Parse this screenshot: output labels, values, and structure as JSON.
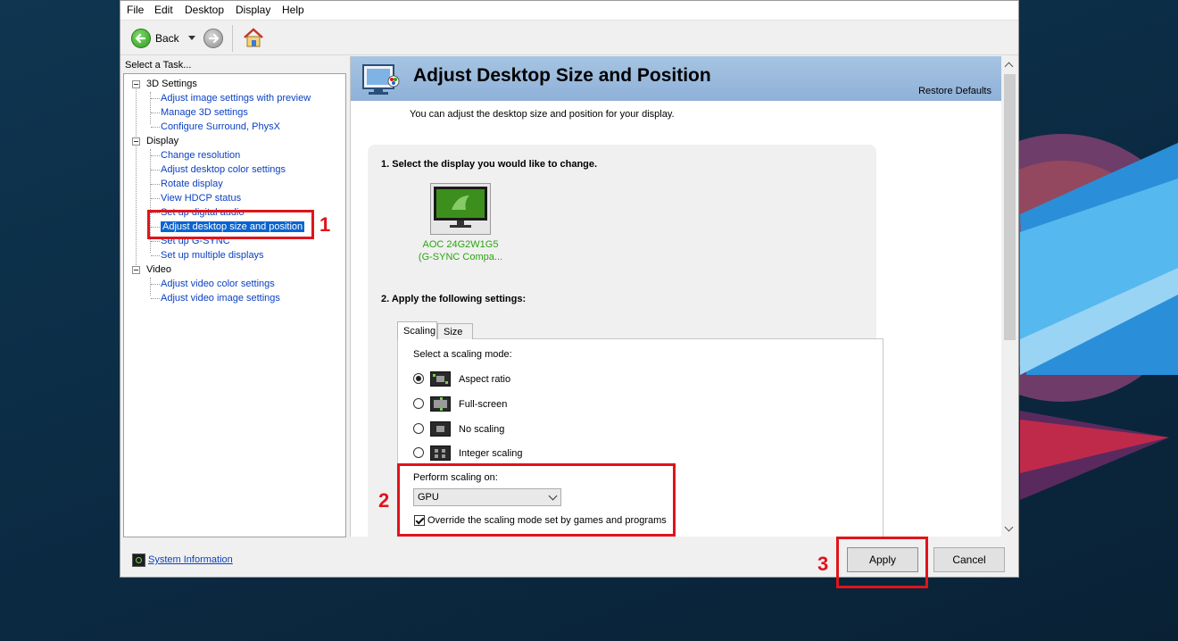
{
  "menu": [
    "File",
    "Edit",
    "Desktop",
    "Display",
    "Help"
  ],
  "toolbar": {
    "back_label": "Back"
  },
  "task_pane": {
    "label": "Select a Task...",
    "groups": [
      {
        "title": "3D Settings",
        "items": [
          "Adjust image settings with preview",
          "Manage 3D settings",
          "Configure Surround, PhysX"
        ]
      },
      {
        "title": "Display",
        "items": [
          "Change resolution",
          "Adjust desktop color settings",
          "Rotate display",
          "View HDCP status",
          "Set up digital audio",
          "Adjust desktop size and position",
          "Set up G-SYNC",
          "Set up multiple displays"
        ]
      },
      {
        "title": "Video",
        "items": [
          "Adjust video color settings",
          "Adjust video image settings"
        ]
      }
    ]
  },
  "content": {
    "title": "Adjust Desktop Size and Position",
    "restore_defaults": "Restore Defaults",
    "description": "You can adjust the desktop size and position for your display.",
    "step1": "1. Select the display you would like to change.",
    "monitor": {
      "name": "AOC 24G2W1G5",
      "subtitle": "(G-SYNC Compa..."
    },
    "step2": "2. Apply the following settings:",
    "tabs": [
      "Scaling",
      "Size"
    ],
    "scaling_mode_label": "Select a scaling mode:",
    "scaling_modes": [
      {
        "label": "Aspect ratio",
        "checked": true
      },
      {
        "label": "Full-screen",
        "checked": false
      },
      {
        "label": "No scaling",
        "checked": false
      },
      {
        "label": "Integer scaling",
        "checked": false
      }
    ],
    "perform_on_label": "Perform scaling on:",
    "perform_on_value": "GPU",
    "override_label": "Override the scaling mode set by games and programs",
    "override_checked": true
  },
  "footer": {
    "system_info": "System Information",
    "apply": "Apply",
    "cancel": "Cancel"
  },
  "annotations": [
    "1",
    "2",
    "3"
  ],
  "colors": {
    "annotation_red": "#e0141b",
    "selection_blue": "#0a64cf",
    "nvidia_green": "#2aa40e"
  }
}
